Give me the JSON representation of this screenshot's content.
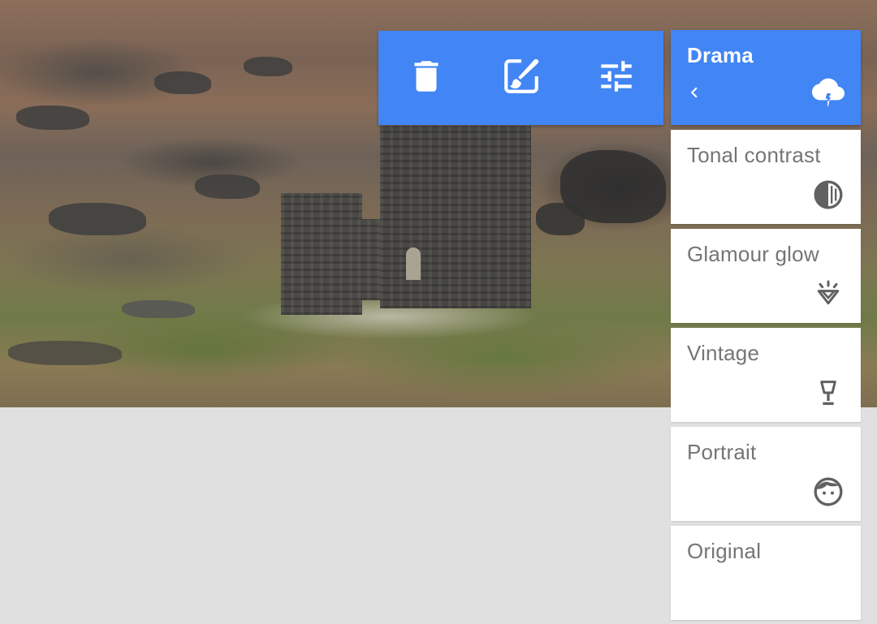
{
  "toolbar": {
    "buttons": [
      {
        "name": "delete-button",
        "icon": "trash-icon"
      },
      {
        "name": "edit-button",
        "icon": "edit-brush-icon"
      },
      {
        "name": "adjust-button",
        "icon": "sliders-icon"
      }
    ]
  },
  "panel": {
    "title": "Drama",
    "back_icon": "chevron-left-icon",
    "active_icon": "storm-cloud-icon",
    "items": [
      {
        "label": "Tonal contrast",
        "icon": "half-circle-contrast-icon"
      },
      {
        "label": "Glamour glow",
        "icon": "diamond-icon"
      },
      {
        "label": "Vintage",
        "icon": "lamp-icon"
      },
      {
        "label": "Portrait",
        "icon": "face-icon"
      },
      {
        "label": "Original",
        "icon": ""
      }
    ]
  },
  "colors": {
    "accent": "#4285f4",
    "item_text": "#757575",
    "item_icon": "#616161",
    "background": "#e0e0e0"
  }
}
